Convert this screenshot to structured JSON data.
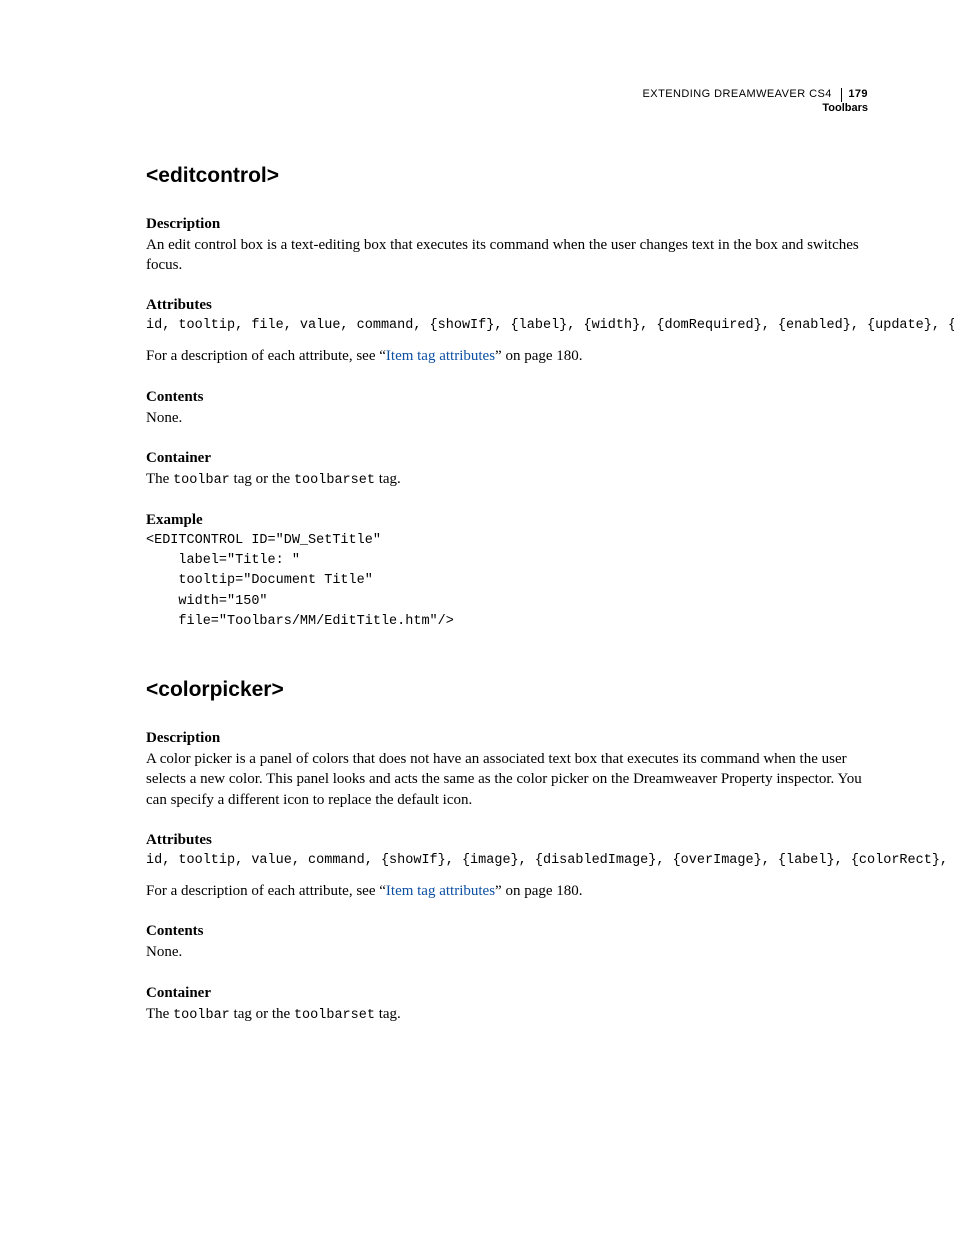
{
  "header": {
    "doc_title": "EXTENDING DREAMWEAVER CS4",
    "page_number": "179",
    "chapter": "Toolbars"
  },
  "section_editcontrol": {
    "title": "<editcontrol>",
    "desc_h": "Description",
    "desc_p": "An edit control box is a text-editing box that executes its command when the user changes text in the box and switches focus.",
    "attr_h": "Attributes",
    "attr_code": "id, tooltip, file, value, command, {showIf}, {label}, {width}, {domRequired}, {enabled}, {update}, {arguments}",
    "attr_desc_pre": "For a description of each attribute, see “",
    "attr_link": "Item tag attributes",
    "attr_desc_post": "” on page 180.",
    "contents_h": "Contents",
    "contents_p": "None.",
    "container_h": "Container",
    "container_pre": "The ",
    "container_code1": "toolbar",
    "container_mid": " tag or the ",
    "container_code2": "toolbarset",
    "container_post": " tag.",
    "example_h": "Example",
    "example_code": "<EDITCONTROL ID=\"DW_SetTitle\"\n    label=\"Title: \"\n    tooltip=\"Document Title\"\n    width=\"150\"\n    file=\"Toolbars/MM/EditTitle.htm\"/>"
  },
  "section_colorpicker": {
    "title": "<colorpicker>",
    "desc_h": "Description",
    "desc_p": "A color picker is a panel of colors that does not have an associated text box that executes its command when the user selects a new color. This panel looks and acts the same as the color picker on the Dreamweaver Property inspector. You can specify a different icon to replace the default icon.",
    "attr_h": "Attributes",
    "attr_code": "id, tooltip, value, command, {showIf}, {image}, {disabledImage}, {overImage}, {label}, {colorRect}, {file}, {domRequired}, {enabled}, {update}, {arguments}",
    "attr_desc_pre": "For a description of each attribute, see “",
    "attr_link": "Item tag attributes",
    "attr_desc_post": "” on page 180.",
    "contents_h": "Contents",
    "contents_p": "None.",
    "container_h": "Container",
    "container_pre": "The ",
    "container_code1": "toolbar",
    "container_mid": " tag or the ",
    "container_code2": "toolbarset",
    "container_post": " tag."
  }
}
